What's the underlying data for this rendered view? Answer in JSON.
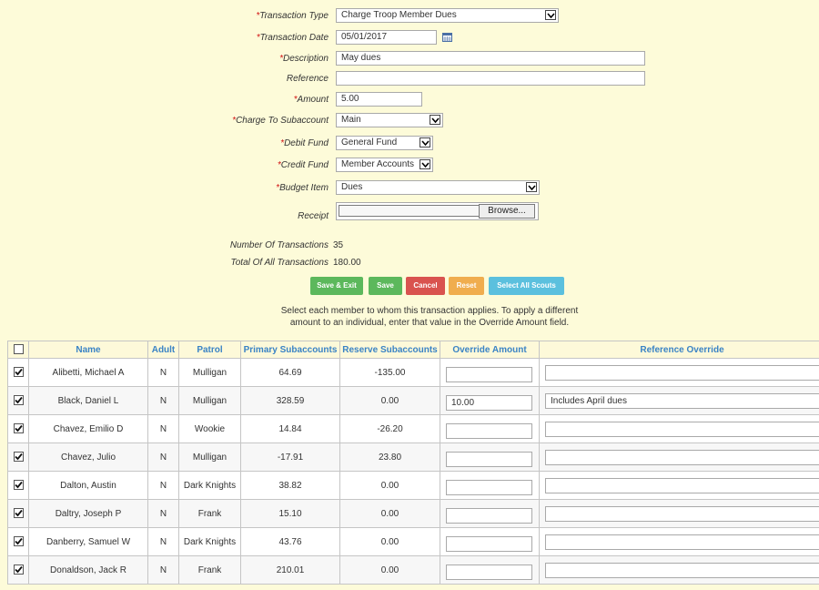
{
  "form": {
    "transaction_type": {
      "label": "Transaction Type",
      "value": "Charge Troop Member Dues"
    },
    "transaction_date": {
      "label": "Transaction Date",
      "value": "05/01/2017"
    },
    "description": {
      "label": "Description",
      "value": "May dues"
    },
    "reference": {
      "label": "Reference",
      "value": ""
    },
    "amount": {
      "label": "Amount",
      "value": "5.00"
    },
    "charge_to_subaccount": {
      "label": "Charge To Subaccount",
      "value": "Main"
    },
    "debit_fund": {
      "label": "Debit Fund",
      "value": "General Fund"
    },
    "credit_fund": {
      "label": "Credit Fund",
      "value": "Member Accounts"
    },
    "budget_item": {
      "label": "Budget Item",
      "value": "Dues"
    },
    "receipt": {
      "label": "Receipt",
      "browse_label": "Browse..."
    },
    "required_mark": "*"
  },
  "summary": {
    "num_transactions_label": "Number Of Transactions",
    "num_transactions": "35",
    "total_label": "Total Of All Transactions",
    "total": "180.00"
  },
  "buttons": {
    "save_exit": "Save & Exit",
    "save": "Save",
    "cancel": "Cancel",
    "reset": "Reset",
    "select_all": "Select All Scouts"
  },
  "colors": {
    "save": "#5cb85c",
    "cancel": "#d9534f",
    "reset": "#f0ad4e",
    "select_all": "#5bc0de",
    "header_text": "#3a83c5",
    "required": "#d01010"
  },
  "instructions": {
    "line1": "Select each member to whom this transaction applies.  To apply a different",
    "line2": "amount to an individual, enter that value in the Override Amount field."
  },
  "table": {
    "headers": {
      "name": "Name",
      "adult": "Adult",
      "patrol": "Patrol",
      "primary": "Primary Subaccounts",
      "reserve": "Reserve Subaccounts",
      "override_amount": "Override Amount",
      "reference_override": "Reference Override"
    },
    "rows": [
      {
        "checked": true,
        "name": "Alibetti, Michael A",
        "adult": "N",
        "patrol": "Mulligan",
        "primary": "64.69",
        "reserve": "-135.00",
        "override_amount": "",
        "reference_override": ""
      },
      {
        "checked": true,
        "name": "Black, Daniel L",
        "adult": "N",
        "patrol": "Mulligan",
        "primary": "328.59",
        "reserve": "0.00",
        "override_amount": "10.00",
        "reference_override": "Includes April dues"
      },
      {
        "checked": true,
        "name": "Chavez, Emilio D",
        "adult": "N",
        "patrol": "Wookie",
        "primary": "14.84",
        "reserve": "-26.20",
        "override_amount": "",
        "reference_override": ""
      },
      {
        "checked": true,
        "name": "Chavez, Julio",
        "adult": "N",
        "patrol": "Mulligan",
        "primary": "-17.91",
        "reserve": "23.80",
        "override_amount": "",
        "reference_override": ""
      },
      {
        "checked": true,
        "name": "Dalton, Austin",
        "adult": "N",
        "patrol": "Dark Knights",
        "primary": "38.82",
        "reserve": "0.00",
        "override_amount": "",
        "reference_override": ""
      },
      {
        "checked": true,
        "name": "Daltry, Joseph P",
        "adult": "N",
        "patrol": "Frank",
        "primary": "15.10",
        "reserve": "0.00",
        "override_amount": "",
        "reference_override": ""
      },
      {
        "checked": true,
        "name": "Danberry, Samuel W",
        "adult": "N",
        "patrol": "Dark Knights",
        "primary": "43.76",
        "reserve": "0.00",
        "override_amount": "",
        "reference_override": ""
      },
      {
        "checked": true,
        "name": "Donaldson, Jack R",
        "adult": "N",
        "patrol": "Frank",
        "primary": "210.01",
        "reserve": "0.00",
        "override_amount": "",
        "reference_override": ""
      }
    ]
  }
}
